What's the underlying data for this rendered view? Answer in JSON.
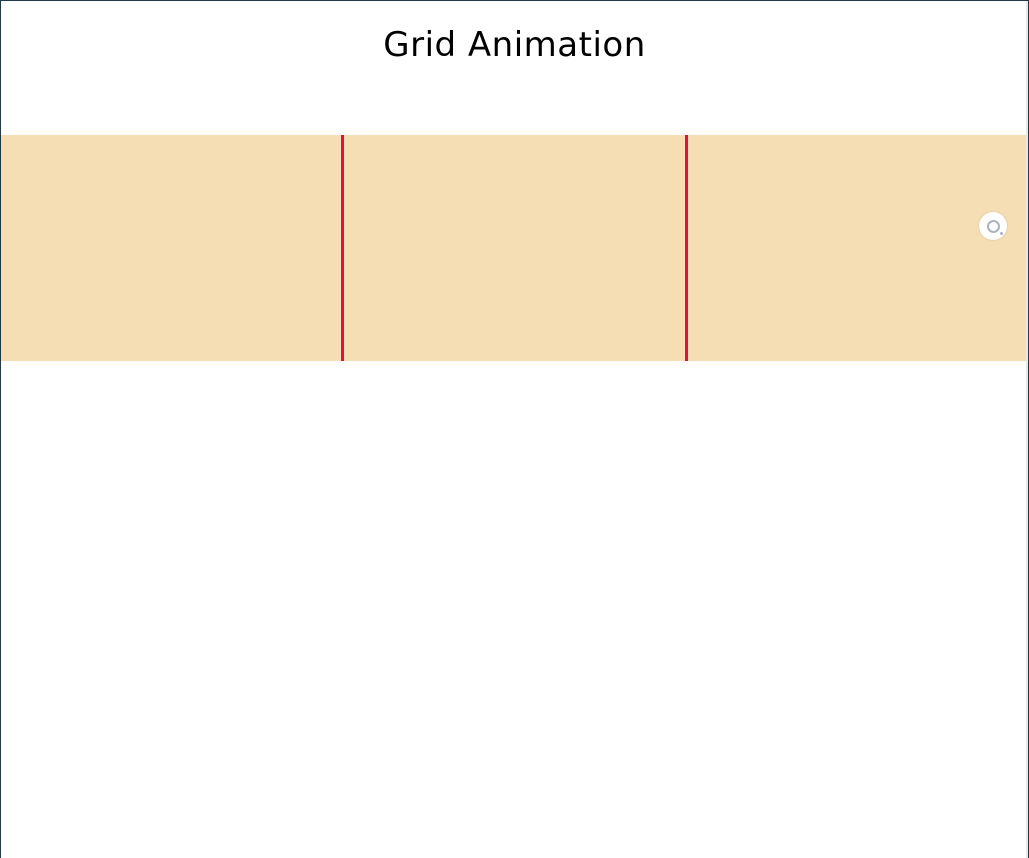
{
  "page": {
    "title": "Grid Animation"
  },
  "grid": {
    "cell_color": "#f5deb3",
    "divider_color": "#dc143c",
    "cells": [
      {
        "id": "cell-1"
      },
      {
        "id": "cell-2"
      },
      {
        "id": "cell-3"
      }
    ]
  },
  "side_badge": {
    "icon": "screenshot-tool-icon"
  }
}
